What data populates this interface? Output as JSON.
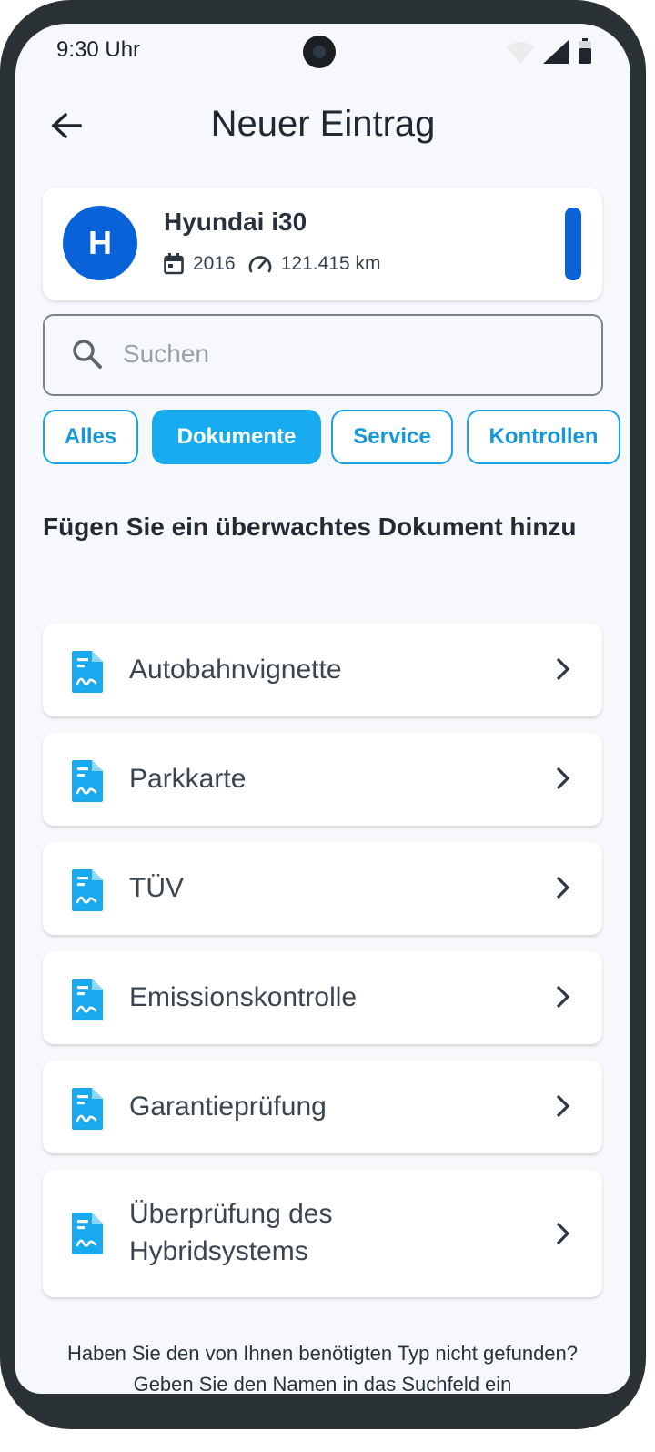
{
  "status_bar": {
    "time": "9:30 Uhr"
  },
  "app_bar": {
    "title": "Neuer Eintrag"
  },
  "vehicle": {
    "initial": "H",
    "name": "Hyundai i30",
    "year": "2016",
    "mileage": "121.415 km",
    "accent_color": "#0a62d8"
  },
  "search": {
    "placeholder": "Suchen"
  },
  "filters": [
    {
      "label": "Alles",
      "active": false
    },
    {
      "label": "Dokumente",
      "active": true
    },
    {
      "label": "Service",
      "active": false
    },
    {
      "label": "Kontrollen",
      "active": false
    }
  ],
  "section_title": "Fügen Sie ein überwachtes Dokument hinzu",
  "documents": [
    {
      "label": "Autobahnvignette"
    },
    {
      "label": "Parkkarte"
    },
    {
      "label": "TÜV"
    },
    {
      "label": "Emissionskontrolle"
    },
    {
      "label": "Garantieprüfung"
    },
    {
      "label": "Überprüfung des Hybridsystems"
    }
  ],
  "footer_hint": "Haben Sie den von Ihnen benötigten Typ nicht gefunden? Geben Sie den Namen in das Suchfeld ein",
  "colors": {
    "chip_accent": "#18abf0",
    "doc_icon": "#1aa8ee"
  }
}
